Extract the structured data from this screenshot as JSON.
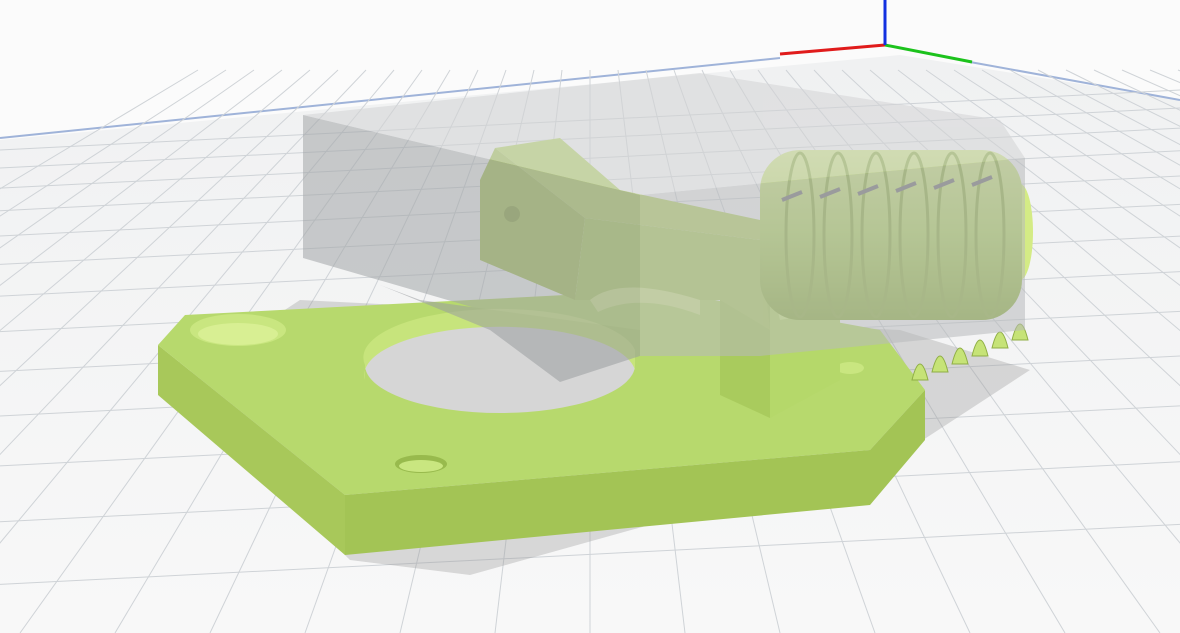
{
  "app": {
    "view": "3D viewport",
    "mode": "preview"
  },
  "build_plate": {
    "grid_color": "#cfd3d7",
    "surface_color": "#f4f5f6",
    "edge_color": "#9fb3d9"
  },
  "axes": {
    "x_color": "#e01b1b",
    "y_color": "#1cc21c",
    "z_color": "#1230e0"
  },
  "model": {
    "color": "#b5d96b",
    "shadow_color": "#9fbd52",
    "hole_color": "#c9e680"
  },
  "support_volume": {
    "color": "#8f9294",
    "opacity": 0.55
  }
}
